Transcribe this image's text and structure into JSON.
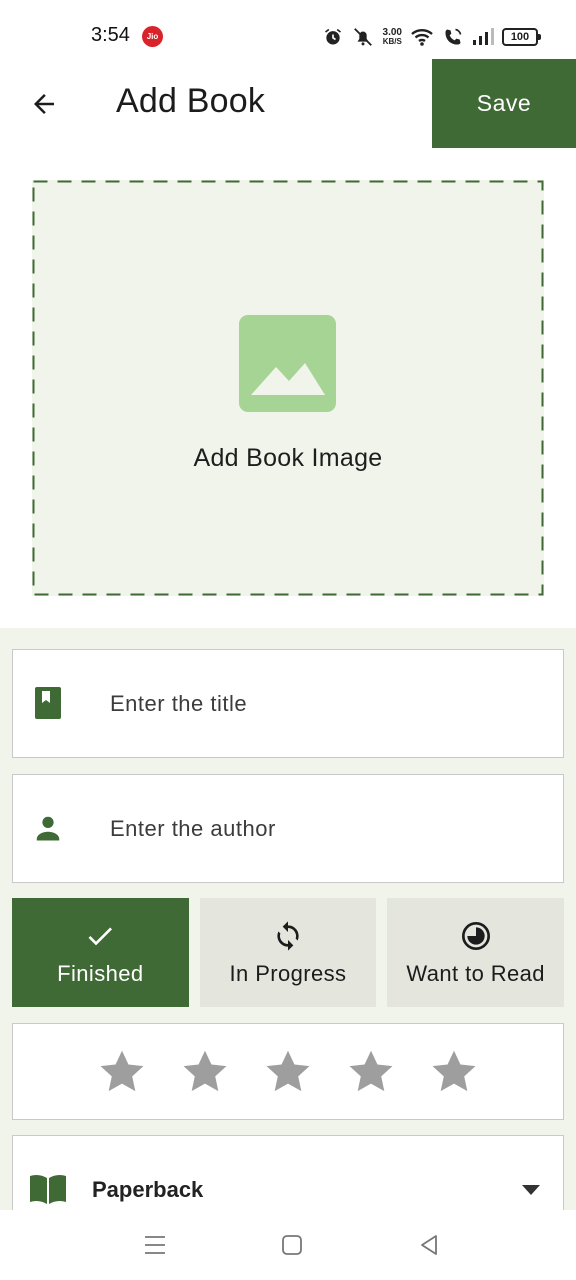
{
  "status_bar": {
    "time": "3:54",
    "carrier_badge": "Jio",
    "network_speed": "3.00",
    "network_unit": "KB/S",
    "battery": "100",
    "icons": [
      "alarm-icon",
      "mute-icon",
      "wifi-icon",
      "wifi-call-icon",
      "signal-icon",
      "battery-icon"
    ]
  },
  "app_bar": {
    "title": "Add Book",
    "save_label": "Save",
    "back_icon": "arrow-back-icon"
  },
  "image_picker": {
    "label": "Add Book Image",
    "icon": "image-placeholder-icon"
  },
  "form": {
    "title_field": {
      "icon": "bookmark-book-icon",
      "placeholder": "Enter the title",
      "value": ""
    },
    "author_field": {
      "icon": "person-icon",
      "placeholder": "Enter the author",
      "value": ""
    },
    "status_options": [
      {
        "label": "Finished",
        "icon": "check-icon",
        "selected": true
      },
      {
        "label": "In Progress",
        "icon": "sync-icon",
        "selected": false
      },
      {
        "label": "Want to Read",
        "icon": "half-clock-icon",
        "selected": false
      }
    ],
    "rating": {
      "value": 0,
      "max": 5
    },
    "format": {
      "icon": "open-book-icon",
      "selected": "Paperback"
    }
  },
  "colors": {
    "accent": "#3f6a35",
    "form_background": "#f1f4eb",
    "image_icon": "#a5d495",
    "star_inactive": "#9e9e9e",
    "segment_inactive": "#e4e6dd"
  }
}
